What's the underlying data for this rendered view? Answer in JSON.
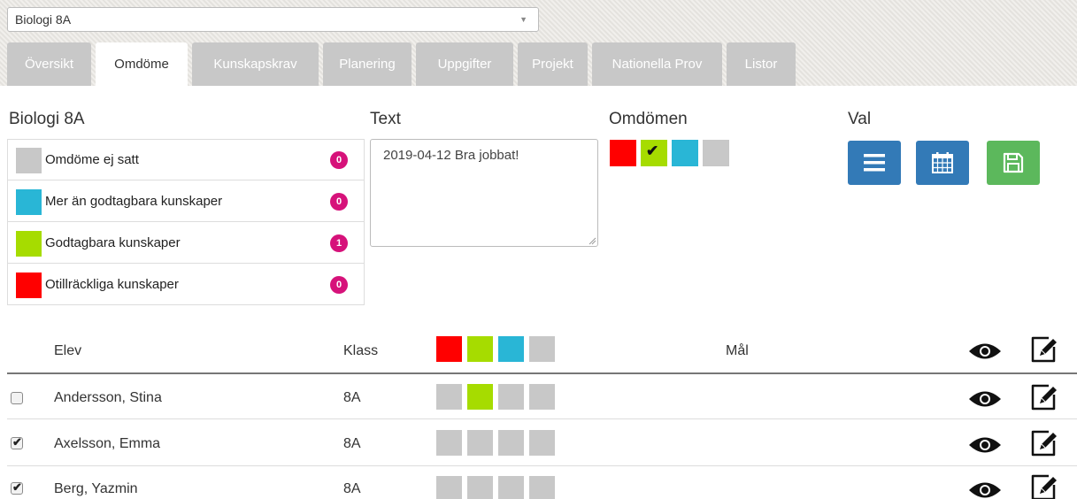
{
  "course_select": {
    "value": "Biologi 8A"
  },
  "tabs": [
    {
      "label": "Översikt",
      "active": false
    },
    {
      "label": "Omdöme",
      "active": true
    },
    {
      "label": "Kunskapskrav",
      "active": false
    },
    {
      "label": "Planering",
      "active": false
    },
    {
      "label": "Uppgifter",
      "active": false
    },
    {
      "label": "Projekt",
      "active": false
    },
    {
      "label": "Nationella Prov",
      "active": false
    },
    {
      "label": "Listor",
      "active": false
    }
  ],
  "sections": {
    "legend_title": "Biologi 8A",
    "text_title": "Text",
    "omdomen_title": "Omdömen",
    "val_title": "Val"
  },
  "legend": [
    {
      "label": "Omdöme ej satt",
      "count": "0",
      "color": "#c8c8c8"
    },
    {
      "label": "Mer än godtagbara kunskaper",
      "count": "0",
      "color": "#29b6d6"
    },
    {
      "label": "Godtagbara kunskaper",
      "count": "1",
      "color": "#a6dc00"
    },
    {
      "label": "Otillräckliga kunskaper",
      "count": "0",
      "color": "#ff0000"
    }
  ],
  "comment": {
    "value": "2019-04-12 Bra jobbat!"
  },
  "grade_colors": [
    "#ff0000",
    "#a6dc00",
    "#29b6d6",
    "#c8c8c8"
  ],
  "selected_grade_index": 1,
  "val_buttons": [
    {
      "icon": "list-icon",
      "color": "#337ab7"
    },
    {
      "icon": "calendar-icon",
      "color": "#337ab7"
    },
    {
      "icon": "save-icon",
      "color": "#5cb85c"
    }
  ],
  "table": {
    "headers": {
      "student": "Elev",
      "class": "Klass",
      "goal": "Mål"
    },
    "rows": [
      {
        "name": "Andersson, Stina",
        "class": "8A",
        "checked": false,
        "grade_index": 1
      },
      {
        "name": "Axelsson, Emma",
        "class": "8A",
        "checked": true,
        "grade_index": null
      },
      {
        "name": "Berg, Yazmin",
        "class": "8A",
        "checked": true,
        "grade_index": null
      }
    ]
  }
}
